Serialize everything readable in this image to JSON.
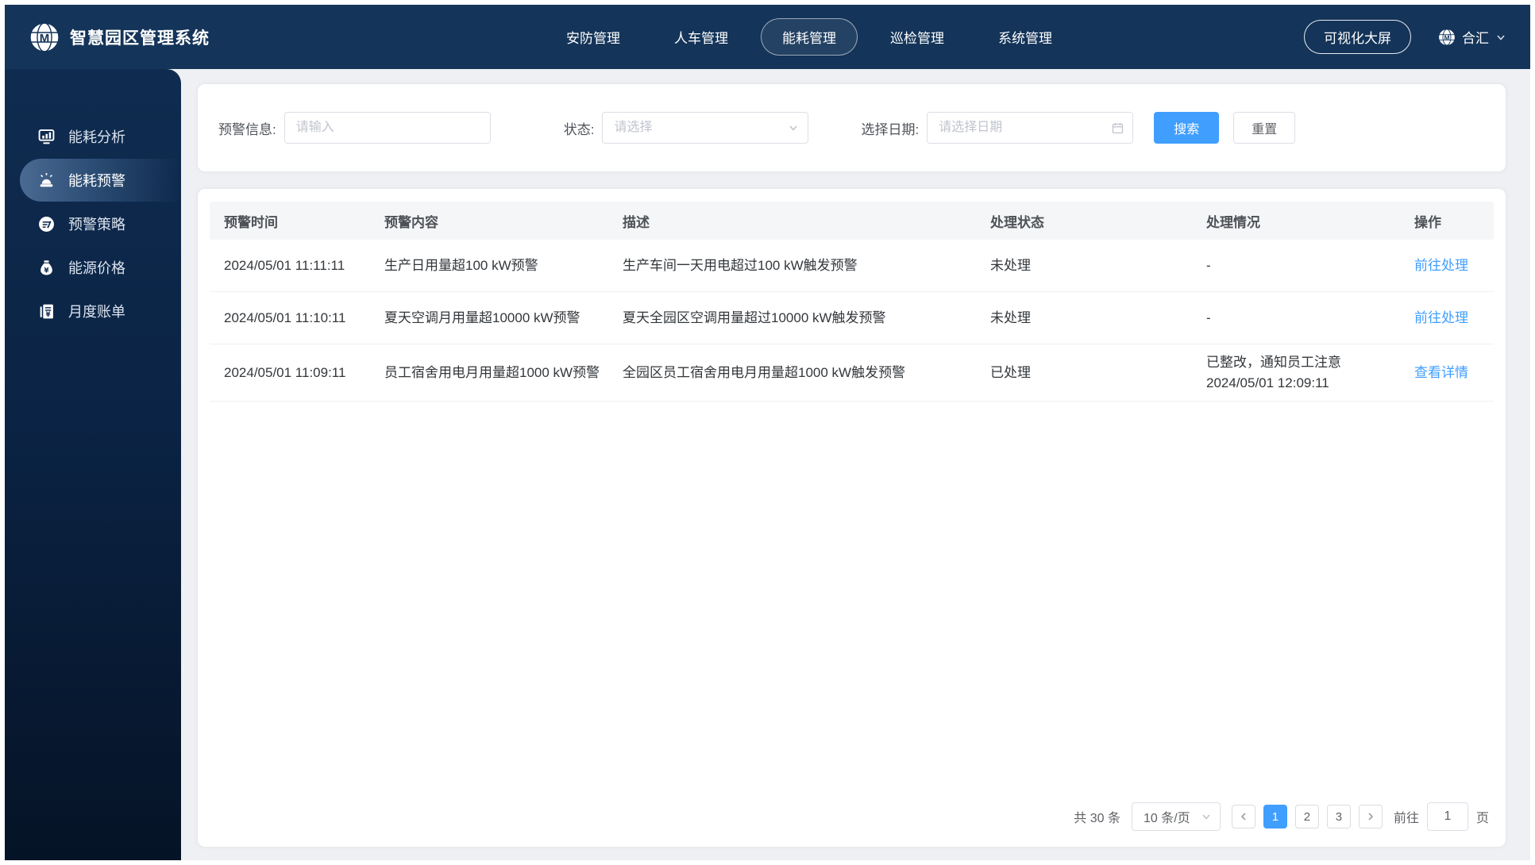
{
  "header": {
    "title": "智慧园区管理系统",
    "nav": [
      {
        "label": "安防管理",
        "active": false
      },
      {
        "label": "人车管理",
        "active": false
      },
      {
        "label": "能耗管理",
        "active": true
      },
      {
        "label": "巡检管理",
        "active": false
      },
      {
        "label": "系统管理",
        "active": false
      }
    ],
    "big_screen_button": "可视化大屏",
    "user": {
      "name": "合汇",
      "avatar_icon": "globe-logo-icon",
      "dropdown_icon": "chevron-down-icon"
    },
    "logo_icon": "globe-logo-icon"
  },
  "sidebar": {
    "items": [
      {
        "label": "能耗分析",
        "icon": "chart-monitor-icon",
        "active": false
      },
      {
        "label": "能耗预警",
        "icon": "alarm-siren-icon",
        "active": true
      },
      {
        "label": "预警策略",
        "icon": "strategy-pen-icon",
        "active": false
      },
      {
        "label": "能源价格",
        "icon": "money-bag-icon",
        "active": false
      },
      {
        "label": "月度账单",
        "icon": "bill-receipt-icon",
        "active": false
      }
    ]
  },
  "filters": {
    "info_label": "预警信息:",
    "info_placeholder": "请输入",
    "status_label": "状态:",
    "status_placeholder": "请选择",
    "date_label": "选择日期:",
    "date_placeholder": "请选择日期",
    "search_label": "搜索",
    "reset_label": "重置"
  },
  "table": {
    "columns": [
      "预警时间",
      "预警内容",
      "描述",
      "处理状态",
      "处理情况",
      "操作"
    ],
    "rows": [
      {
        "time": "2024/05/01 11:11:11",
        "content": "生产日用量超100 kW预警",
        "desc": "生产车间一天用电超过100 kW触发预警",
        "status": "未处理",
        "handle": "-",
        "handle_line2": "",
        "action": "前往处理"
      },
      {
        "time": "2024/05/01 11:10:11",
        "content": "夏天空调月用量超10000 kW预警",
        "desc": "夏天全园区空调用量超过10000 kW触发预警",
        "status": "未处理",
        "handle": "-",
        "handle_line2": "",
        "action": "前往处理"
      },
      {
        "time": "2024/05/01 11:09:11",
        "content": "员工宿舍用电月用量超1000 kW预警",
        "desc": "全园区员工宿舍用电月用量超1000 kW触发预警",
        "status": "已处理",
        "handle": "已整改，通知员工注意",
        "handle_line2": "2024/05/01 12:09:11",
        "action": "查看详情"
      }
    ]
  },
  "pagination": {
    "total": "共 30 条",
    "page_size": "10 条/页",
    "pages": [
      "1",
      "2",
      "3"
    ],
    "active_page": "1",
    "goto_label": "前往",
    "goto_value": "1",
    "page_suffix": "页"
  },
  "colors": {
    "accent_blue": "#409eff",
    "header_navy": "#143459",
    "sidebar_navy_top": "#0f2c50",
    "sidebar_navy_bottom": "#051326",
    "table_header_bg": "#f5f6f8"
  }
}
